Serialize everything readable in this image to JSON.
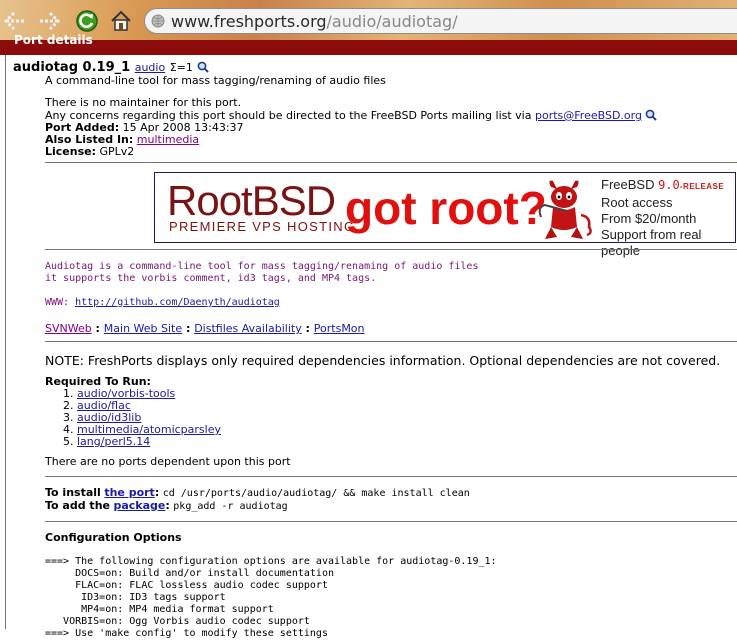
{
  "browser": {
    "url_host": "www.freshports.org",
    "url_path": "/audio/audiotag/"
  },
  "page": {
    "section_header": "Port details",
    "port": {
      "name": "audiotag 0.19_1",
      "category_link": "audio",
      "sigma": "Σ=1",
      "summary": "A command-line tool for mass tagging/renaming of audio files",
      "maintainer_note": "There is no maintainer for this port.",
      "concerns_prefix": "Any concerns regarding this port should be directed to the FreeBSD Ports mailing list via",
      "concerns_email": "ports@FreeBSD.org",
      "port_added_label": "Port Added:",
      "port_added_value": "15 Apr 2008 13:43:37",
      "also_listed_label": "Also Listed In:",
      "also_listed_value": "multimedia",
      "license_label": "License:",
      "license_value": "GPLv2"
    },
    "banner": {
      "brand": "RootBSD",
      "tagline": "PREMIERE VPS HOSTING",
      "slogan": "got root?",
      "line1_prefix": "FreeBSD",
      "line1_version": "9.0",
      "line1_release": "-RELEASE",
      "line2": "Root access",
      "line3": "From $20/month",
      "line4": "Support from real people",
      "colors": {
        "brand": "#7a1313",
        "slogan": "#e20f0f"
      }
    },
    "description": {
      "line1": "Audiotag is a command-line tool for mass tagging/renaming of audio files",
      "line2": "it supports the vorbis comment, id3 tags, and MP4 tags.",
      "www_label": "WWW:",
      "www_url": "http://github.com/Daenyth/audiotag"
    },
    "links": {
      "svnweb": "SVNWeb",
      "main_site": "Main Web Site",
      "distfiles": "Distfiles Availability",
      "portsmon": "PortsMon",
      "sep": " : "
    },
    "note": "NOTE: FreshPorts displays only required dependencies information. Optional dependencies are not covered.",
    "required_to_run": {
      "label": "Required To Run:",
      "items": [
        "audio/vorbis-tools",
        "audio/flac",
        "audio/id3lib",
        "multimedia/atomicparsley",
        "lang/perl5.14"
      ]
    },
    "no_dependents": "There are no ports dependent upon this port",
    "install": {
      "to_install_prefix": "To install",
      "the_port": "the port",
      "install_cmd": "cd /usr/ports/audio/audiotag/ && make install clean",
      "to_add_prefix": "To add the",
      "package": "package",
      "add_cmd": "pkg_add -r audiotag"
    },
    "config": {
      "heading": "Configuration Options",
      "lines": [
        "===> The following configuration options are available for audiotag-0.19_1:",
        "     DOCS=on: Build and/or install documentation",
        "     FLAC=on: FLAC lossless audio codec support",
        "      ID3=on: ID3 tags support",
        "      MP4=on: MP4 media format support",
        "   VORBIS=on: Ogg Vorbis audio codec support",
        "===> Use 'make config' to modify these settings"
      ]
    }
  }
}
